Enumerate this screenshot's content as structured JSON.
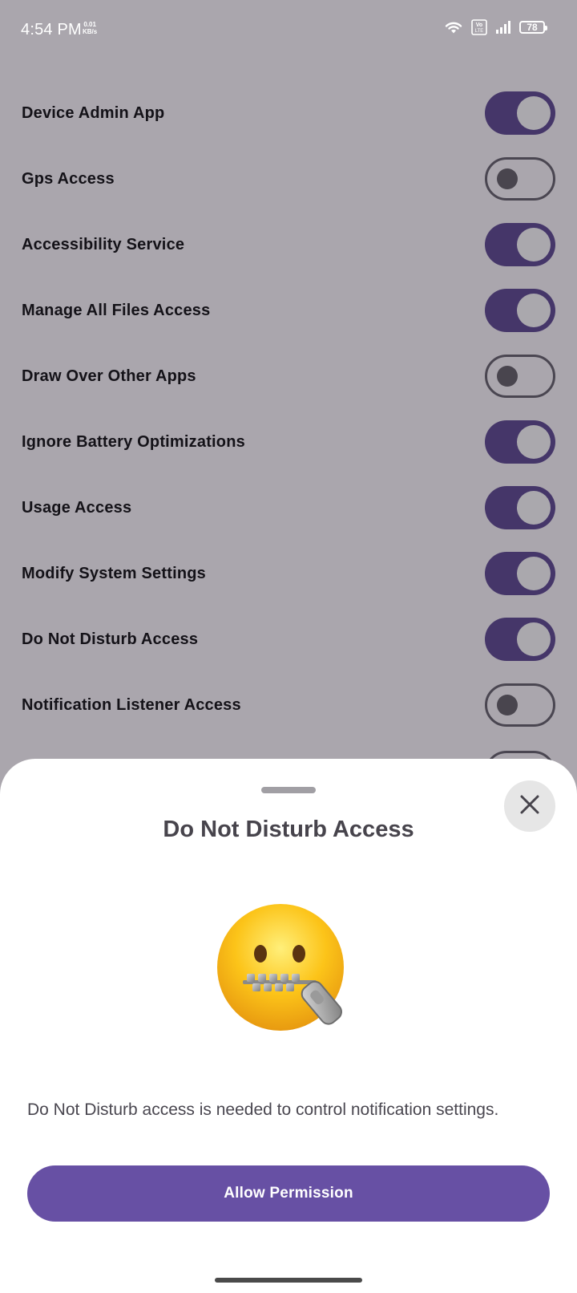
{
  "status_bar": {
    "time": "4:54 PM",
    "speed_value": "0.01",
    "speed_unit": "KB/s",
    "battery": "78",
    "volte_label": "Vo LTE"
  },
  "permissions": [
    {
      "label": "Device Admin App",
      "enabled": true
    },
    {
      "label": "Gps Access",
      "enabled": false
    },
    {
      "label": "Accessibility Service",
      "enabled": true
    },
    {
      "label": "Manage All Files Access",
      "enabled": true
    },
    {
      "label": "Draw Over Other Apps",
      "enabled": false
    },
    {
      "label": "Ignore Battery Optimizations",
      "enabled": true
    },
    {
      "label": "Usage Access",
      "enabled": true
    },
    {
      "label": "Modify System Settings",
      "enabled": true
    },
    {
      "label": "Do Not Disturb Access",
      "enabled": true
    },
    {
      "label": "Notification Listener Access",
      "enabled": false
    }
  ],
  "sheet": {
    "title": "Do Not Disturb Access",
    "emoji_name": "zipper-mouth-face-icon",
    "description": "Do Not Disturb access is needed to control notification settings.",
    "allow_button": "Allow Permission",
    "close_icon": "close-icon"
  },
  "colors": {
    "toggle_on": "#453669",
    "primary_button": "#6750a4",
    "scrim_background": "#aaa6ad"
  }
}
